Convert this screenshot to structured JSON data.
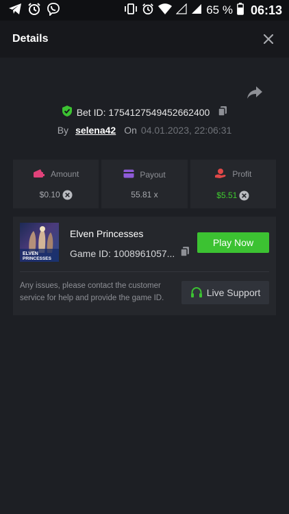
{
  "status_bar": {
    "battery_percent": "65 %",
    "time": "06:13",
    "icons": [
      "telegram-icon",
      "alarm-icon",
      "viber-icon",
      "vibrate-icon",
      "alarm-icon",
      "wifi-icon",
      "signal-icon",
      "signal-icon",
      "battery-icon"
    ]
  },
  "header": {
    "title": "Details",
    "close_icon": "close-icon"
  },
  "bet": {
    "id_text": "Bet ID: 1754127549452662400",
    "by_label": "By",
    "username": "selena42",
    "on_label": "On",
    "date": "04.01.2023, 22:06:31"
  },
  "stats": [
    {
      "label": "Amount",
      "value": "$0.10",
      "icon": "wallet-icon",
      "show_x": true
    },
    {
      "label": "Payout",
      "value": "55.81 x",
      "icon": "card-icon",
      "show_x": false
    },
    {
      "label": "Profit",
      "value": "$5.51",
      "icon": "hand-coin-icon",
      "show_x": true
    }
  ],
  "game": {
    "name": "Elven Princesses",
    "id_text": "Game ID: 1008961057...",
    "thumb_text_1": "ELVEN",
    "thumb_text_2": "PRINCESSES",
    "play_label": "Play Now"
  },
  "support": {
    "text": "Any issues, please contact the customer service for help and provide the game ID.",
    "button_label": "Live Support"
  },
  "colors": {
    "background": "#1d1f24",
    "header": "#17181c",
    "card": "#25272c",
    "accent_green": "#3cc232",
    "amount_icon": "#e0427a",
    "payout_icon": "#8e5bd8",
    "profit_icon": "#e04848"
  }
}
